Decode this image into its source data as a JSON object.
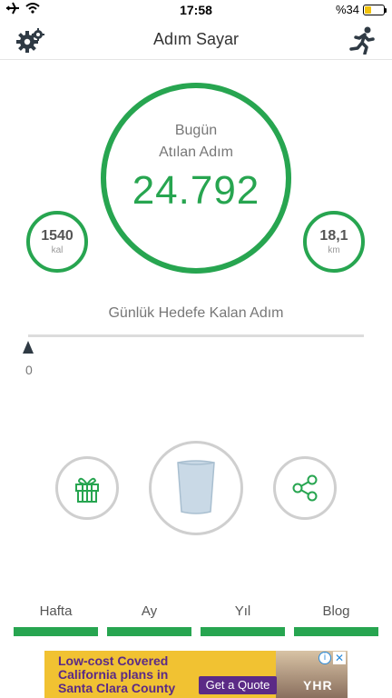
{
  "status_bar": {
    "time": "17:58",
    "battery_text": "%34",
    "battery_level": 0.34,
    "left_icons": [
      "airplane-icon",
      "wifi-icon"
    ]
  },
  "nav": {
    "title": "Adım Sayar",
    "left_icon": "gear-icon",
    "right_icon": "running-icon"
  },
  "today": {
    "label_line1": "Bugün",
    "label_line2": "Atılan Adım",
    "steps": "24.792"
  },
  "calories": {
    "value": "1540",
    "unit": "kal"
  },
  "distance": {
    "value": "18,1",
    "unit": "km"
  },
  "goal": {
    "title": "Günlük Hedefe Kalan Adım",
    "value": "0",
    "progress": 0
  },
  "actions": {
    "gift_icon": "gift-icon",
    "cup_icon": "water-cup-icon",
    "share_icon": "share-icon"
  },
  "tabs": [
    {
      "label": "Hafta"
    },
    {
      "label": "Ay"
    },
    {
      "label": "Yıl"
    },
    {
      "label": "Blog"
    }
  ],
  "ad": {
    "line1": "Low-cost Covered",
    "line2": "California plans in",
    "line3": "Santa Clara County",
    "cta": "Get a Quote",
    "logo": "YHR",
    "info_icon": "info-icon",
    "close_icon": "close-icon"
  },
  "colors": {
    "accent": "#27a550",
    "ring_gray": "#cfcfcf",
    "ad_yellow": "#f1c232",
    "ad_purple": "#5b2a86"
  }
}
